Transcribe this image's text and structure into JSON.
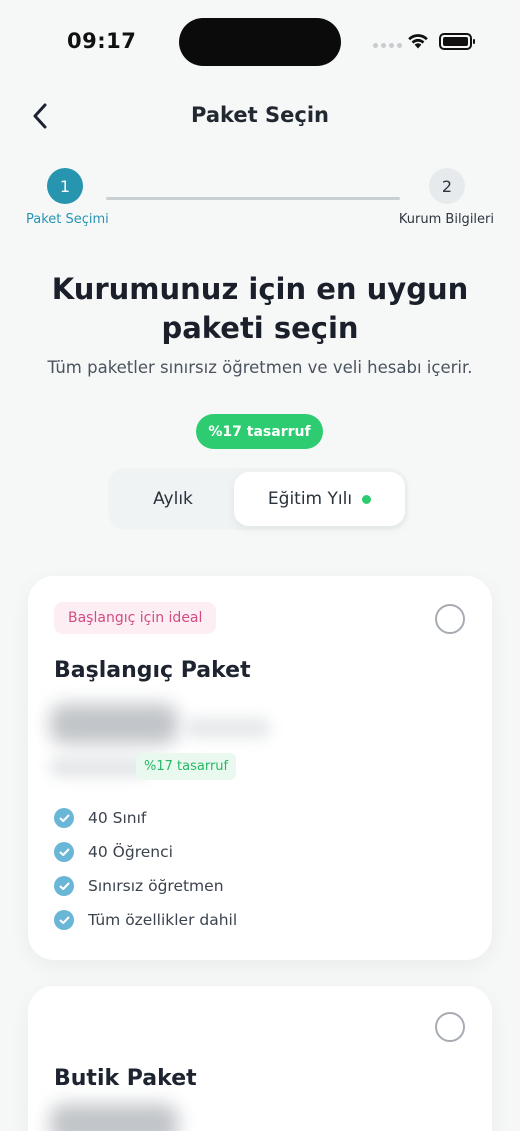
{
  "status_bar": {
    "time": "09:17"
  },
  "nav": {
    "title": "Paket Seçin"
  },
  "stepper": {
    "steps": [
      {
        "number": "1",
        "label": "Paket Seçimi"
      },
      {
        "number": "2",
        "label": "Kurum Bilgileri"
      }
    ]
  },
  "hero": {
    "heading": "Kurumunuz için en uygun paketi seçin",
    "subheading": "Tüm paketler sınırsız öğretmen ve veli hesabı içerir."
  },
  "billing": {
    "savings_badge": "%17 tasarruf",
    "options": [
      "Aylık",
      "Eğitim Yılı"
    ],
    "selected": "Eğitim Yılı"
  },
  "plans": [
    {
      "tag": "Başlangıç için ideal",
      "name": "Başlangıç Paket",
      "savings": "%17 tasarruf",
      "features": [
        "40 Sınıf",
        "40 Öğrenci",
        "Sınırsız öğretmen",
        "Tüm özellikler dahil"
      ]
    },
    {
      "name": "Butik Paket"
    }
  ],
  "colors": {
    "primary": "#2794b0",
    "success": "#2ecc71",
    "tag_text": "#d34c84",
    "tag_bg": "#fdeef4",
    "check": "#6ab6d6"
  }
}
